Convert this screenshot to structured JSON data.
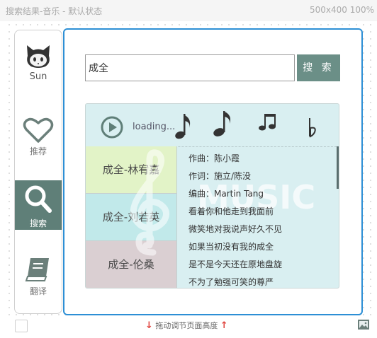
{
  "page": {
    "title": "搜索结果-音乐 - 默认状态",
    "size_label": "500x400  100%"
  },
  "sidebar": {
    "items": [
      {
        "label": "Sun",
        "icon": "github-cat-icon"
      },
      {
        "label": "推荐",
        "icon": "heart-icon"
      },
      {
        "label": "搜索",
        "icon": "search-icon",
        "active": true
      },
      {
        "label": "翻译",
        "icon": "book-icon"
      }
    ]
  },
  "search": {
    "value": "成全",
    "button_label": "搜 索"
  },
  "player": {
    "status": "loading...",
    "notes": [
      "eighth-note-icon",
      "quarter-note-icon",
      "beamed-notes-icon",
      "flat-icon"
    ]
  },
  "songs": [
    {
      "title": "成全-林宥嘉"
    },
    {
      "title": "成全-刘若英"
    },
    {
      "title": "成全-伦桑"
    }
  ],
  "lyrics": [
    "作曲：陈小霞",
    "作词：施立/陈没",
    "编曲：Martin Tang",
    "看着你和他走到我面前",
    "微笑地对我说声好久不见",
    "如果当初没有我的成全",
    "是不是今天还在原地盘旋",
    "不为了勉强可笑的尊严"
  ],
  "watermark_text": "MUSIC",
  "footer": {
    "resize_hint": "拖动调节页面高度"
  },
  "colors": {
    "accent_frame": "#2d8fd5",
    "nav_active": "#5f7f78",
    "search_button": "#6b8f87",
    "panel_bg": "#d9eff1",
    "song1_bg": "#e2f3c7",
    "song2_bg": "#c1e9ea",
    "song3_bg": "#dacfd2",
    "arrow": "#e0443e"
  }
}
